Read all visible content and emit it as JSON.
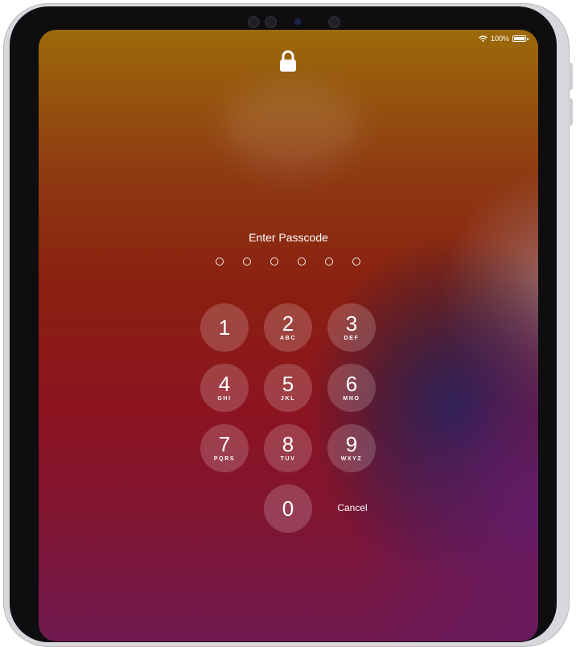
{
  "status_bar": {
    "battery_text": "100%",
    "wifi_icon": "wifi-icon",
    "battery_icon": "battery-icon"
  },
  "lock_icon": "lock-icon",
  "prompt": "Enter Passcode",
  "passcode_length": 6,
  "keypad": {
    "k1": {
      "digit": "1",
      "letters": ""
    },
    "k2": {
      "digit": "2",
      "letters": "ABC"
    },
    "k3": {
      "digit": "3",
      "letters": "DEF"
    },
    "k4": {
      "digit": "4",
      "letters": "GHI"
    },
    "k5": {
      "digit": "5",
      "letters": "JKL"
    },
    "k6": {
      "digit": "6",
      "letters": "MNO"
    },
    "k7": {
      "digit": "7",
      "letters": "PQRS"
    },
    "k8": {
      "digit": "8",
      "letters": "TUV"
    },
    "k9": {
      "digit": "9",
      "letters": "WXYZ"
    },
    "k0": {
      "digit": "0",
      "letters": ""
    }
  },
  "cancel_label": "Cancel",
  "colors": {
    "key_fill": "rgba(255,255,255,0.18)",
    "text": "#ffffff"
  }
}
